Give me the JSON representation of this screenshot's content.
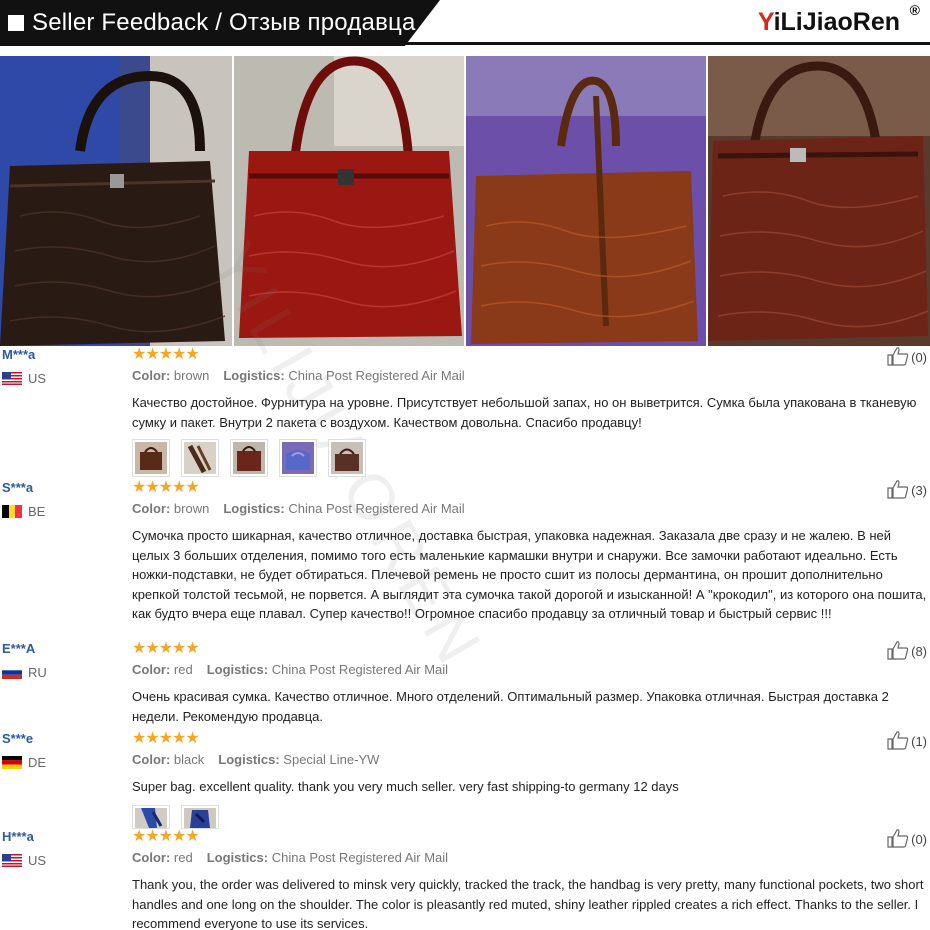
{
  "header": {
    "title": "Seller Feedback / Отзыв продавца",
    "brand": "YiLiJiaoRen",
    "brand_mark": "®"
  },
  "watermark": "YILIJIAOREN",
  "photos": [
    {
      "name": "photo-black-handbag",
      "color": "#2a1a14"
    },
    {
      "name": "photo-red-handbag",
      "color": "#9a1712"
    },
    {
      "name": "photo-brown-handbag",
      "color": "#8a3a18"
    },
    {
      "name": "photo-burgundy-handbag",
      "color": "#6b2416"
    }
  ],
  "labels": {
    "color": "Color:",
    "logistics": "Logistics:"
  },
  "reviews": [
    {
      "name": "M***a",
      "country": "US",
      "stars": "★★★★★",
      "color": "brown",
      "logistics": "China Post Registered Air Mail",
      "likes": "(0)",
      "text": "Качество достойное. Фурнитура на уровне. Присутствует небольшой запах, но он выветрится. Сумка была упакована в тканевую сумку и пакет. Внутри 2 пакета с воздухом. Качеством довольна. Спасибо продавцу!"
    },
    {
      "name": "S***a",
      "country": "BE",
      "stars": "★★★★★",
      "color": "brown",
      "logistics": "China Post Registered Air Mail",
      "likes": "(3)",
      "text": "Сумочка просто шикарная, качество отличное, доставка быстрая, упаковка надежная. Заказала две сразу и не жалею. В ней целых 3 больших отделения, помимо того есть маленькие кармашки внутри и снаружи. Все замочки работают идеально. Есть ножки-подставки, не будет обтираться. Плечевой ремень не просто сшит из полосы дермантина, он прошит дополнительно крепкой толстой тесьмой, не порвется. А выглядит эта сумочка такой дорогой и изысканной! А \"крокодил\", из которого она пошита, как будто вчера еще плавал. Супер качество!! Огромное спасибо продавцу за отличный товар и быстрый сервис !!!"
    },
    {
      "name": "E***A",
      "country": "RU",
      "stars": "★★★★★",
      "color": "red",
      "logistics": "China Post Registered Air Mail",
      "likes": "(8)",
      "text": "Очень красивая сумка. Качество отличное. Много отделений. Оптимальный размер. Упаковка отличная. Быстрая доставка 2 недели. Рекомендую продавца."
    },
    {
      "name": "S***e",
      "country": "DE",
      "stars": "★★★★★",
      "color": "black",
      "logistics": "Special Line-YW",
      "likes": "(1)",
      "text": "Super bag. excellent quality. thank you very much seller. very fast shipping-to germany 12 days"
    },
    {
      "name": "H***a",
      "country": "US",
      "stars": "★★★★★",
      "color": "red",
      "logistics": "China Post Registered Air Mail",
      "likes": "(0)",
      "text": "Thank you, the order was delivered to minsk very quickly, tracked the track, the handbag is very pretty, many functional pockets, two short handles and one long on the shoulder. The color is pleasantly red muted, shiny leather rippled creates a rich effect. Thanks to the seller. I recommend everyone to use its services."
    }
  ]
}
